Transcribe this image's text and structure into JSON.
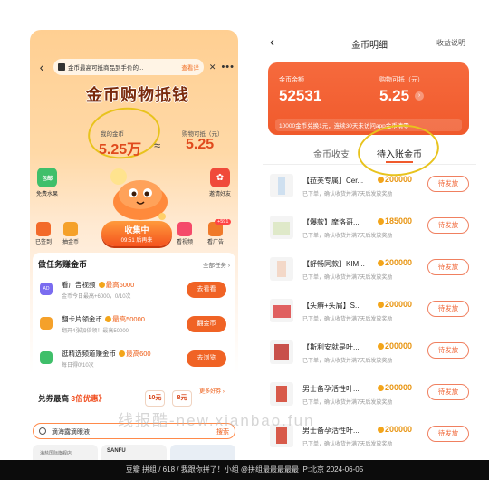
{
  "left": {
    "notice": {
      "text": "金币最高可抵商品到手价的...",
      "link": "查看详"
    },
    "title": "金币购物抵钱",
    "my_coins_label": "我的金币",
    "my_coins_value": "5.25万",
    "approx": "≈",
    "cash_label": "购物可抵（元）",
    "cash_value": "5.25",
    "side_left": {
      "label": "免费水果",
      "tag": "包邮"
    },
    "side_right": {
      "label": "邀请好友"
    },
    "quick": [
      {
        "label": "已签到"
      },
      {
        "label": "抽金币"
      },
      {
        "label": "看视频"
      },
      {
        "label": "看广告"
      }
    ],
    "collect": {
      "label": "收集中",
      "timer": "09:51 后再来"
    },
    "badge": "+591",
    "tasks": {
      "heading": "做任务赚金币",
      "all": "全部任务 ›",
      "items": [
        {
          "icon": "AD",
          "title": "看广告视频",
          "reward": "最高6000",
          "sub": "金币今日最高+6000，0/10次",
          "button": "去看看"
        },
        {
          "icon": "",
          "title": "翻卡片领金币",
          "reward": "最高50000",
          "sub": "翻开4张加倍领！最高50000",
          "button": "翻金币"
        },
        {
          "icon": "",
          "title": "逛精选频道赚金币",
          "reward": "最高600",
          "sub": "每日得0/10次",
          "button": "去浏览"
        }
      ]
    },
    "exchange": {
      "pre": "兑券最高",
      "highlight": "3倍优惠",
      "suffix": "》",
      "opt1": "10元",
      "opt2": "8元",
      "more": "更多好券 ›"
    },
    "search": {
      "text": "滴海露滴眼液",
      "button": "搜索"
    },
    "products": [
      "海盐国际旗舰店",
      "SANFU",
      ""
    ]
  },
  "right": {
    "title": "金币明细",
    "help": "收益说明",
    "balance_label": "金币余额",
    "balance_value": "52531",
    "cash_label": "购物可抵（元）",
    "cash_value": "5.25",
    "footer": "10000金币兑换1元，连续30天未访问app金币清零",
    "tabs": [
      "金币收支",
      "待入账金币"
    ],
    "rows": [
      {
        "name": "【菈芙专属】Cer...",
        "coins": "200000",
        "desc": "已下单，确认收货并满7天后发放奖励",
        "button": "待发放"
      },
      {
        "name": "【爆款】摩洛哥...",
        "coins": "185000",
        "desc": "已下单，确认收货并满7天后发放奖励",
        "button": "待发放"
      },
      {
        "name": "【舒畅同款】KIM...",
        "coins": "200000",
        "desc": "已下单，确认收货并满7天后发放奖励",
        "button": "待发放"
      },
      {
        "name": "【头癣+头屑】S...",
        "coins": "200000",
        "desc": "已下单，确认收货并满7天后发放奖励",
        "button": "待发放"
      },
      {
        "name": "【斯利安就是叶...",
        "coins": "200000",
        "desc": "已下单，确认收货并满7天后发放奖励",
        "button": "待发放"
      },
      {
        "name": "男士备孕活性叶...",
        "coins": "200000",
        "desc": "已下单，确认收货并满7天后发放奖励",
        "button": "待发放"
      },
      {
        "name": "男士备孕活性叶...",
        "coins": "200000",
        "desc": "已下单，确认收货并满7天后发放奖励",
        "button": "待发放"
      }
    ]
  },
  "caption": "豆瓣   拼组 / 618 / 我跟你拼了！小组 @拼组最最最最最 IP:北京 2024-06-05",
  "watermark": "线报酷-new.xianbao.fun"
}
